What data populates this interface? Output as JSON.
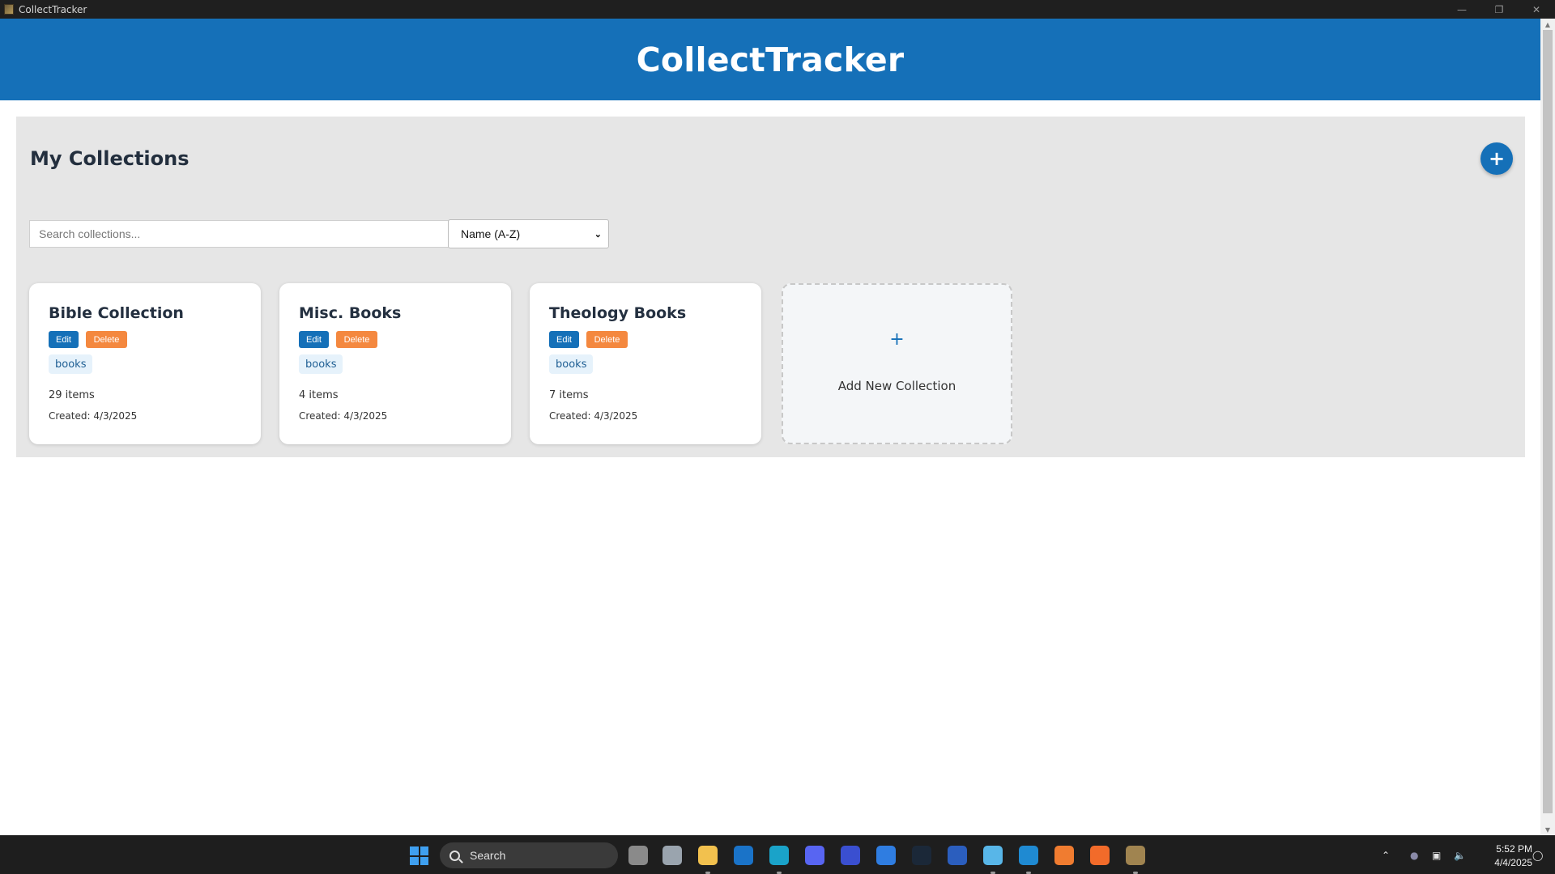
{
  "window": {
    "title": "CollectTracker",
    "controls": {
      "minimize": "—",
      "restore": "❐",
      "close": "✕"
    }
  },
  "header": {
    "title": "CollectTracker"
  },
  "main": {
    "page_title": "My Collections",
    "add_fab": "+",
    "search": {
      "placeholder": "Search collections...",
      "value": ""
    },
    "sort": {
      "selected": "Name (A-Z)"
    },
    "collections": [
      {
        "title": "Bible Collection",
        "edit_label": "Edit",
        "delete_label": "Delete",
        "tag": "books",
        "items": "29 items",
        "created": "Created: 4/3/2025"
      },
      {
        "title": "Misc. Books",
        "edit_label": "Edit",
        "delete_label": "Delete",
        "tag": "books",
        "items": "4 items",
        "created": "Created: 4/3/2025"
      },
      {
        "title": "Theology Books",
        "edit_label": "Edit",
        "delete_label": "Delete",
        "tag": "books",
        "items": "7 items",
        "created": "Created: 4/3/2025"
      }
    ],
    "add_card": {
      "plus": "+",
      "label": "Add New Collection"
    }
  },
  "taskbar": {
    "search_label": "Search",
    "apps": [
      {
        "name": "task-view-icon",
        "color": "#8a8a8a"
      },
      {
        "name": "settings-icon",
        "color": "#9aa4ae"
      },
      {
        "name": "file-explorer-icon",
        "color": "#f2c14e"
      },
      {
        "name": "outlook-icon",
        "color": "#1a73c8"
      },
      {
        "name": "edge-icon",
        "color": "#1aa3c9"
      },
      {
        "name": "discord-icon",
        "color": "#5865f2"
      },
      {
        "name": "app-icon",
        "color": "#3a4fd0"
      },
      {
        "name": "copilot-icon",
        "color": "#2f7de1"
      },
      {
        "name": "steam-icon",
        "color": "#1b2838"
      },
      {
        "name": "word-icon",
        "color": "#2b5ebe"
      },
      {
        "name": "notepad-icon",
        "color": "#58b6e8"
      },
      {
        "name": "vscode-icon",
        "color": "#1f8ad2"
      },
      {
        "name": "xampp-icon",
        "color": "#f07c30"
      },
      {
        "name": "brave-icon",
        "color": "#f26b2a"
      },
      {
        "name": "collecttracker-icon",
        "color": "#a08450"
      }
    ],
    "clock": {
      "time": "5:52 PM",
      "date": "4/4/2025"
    }
  }
}
